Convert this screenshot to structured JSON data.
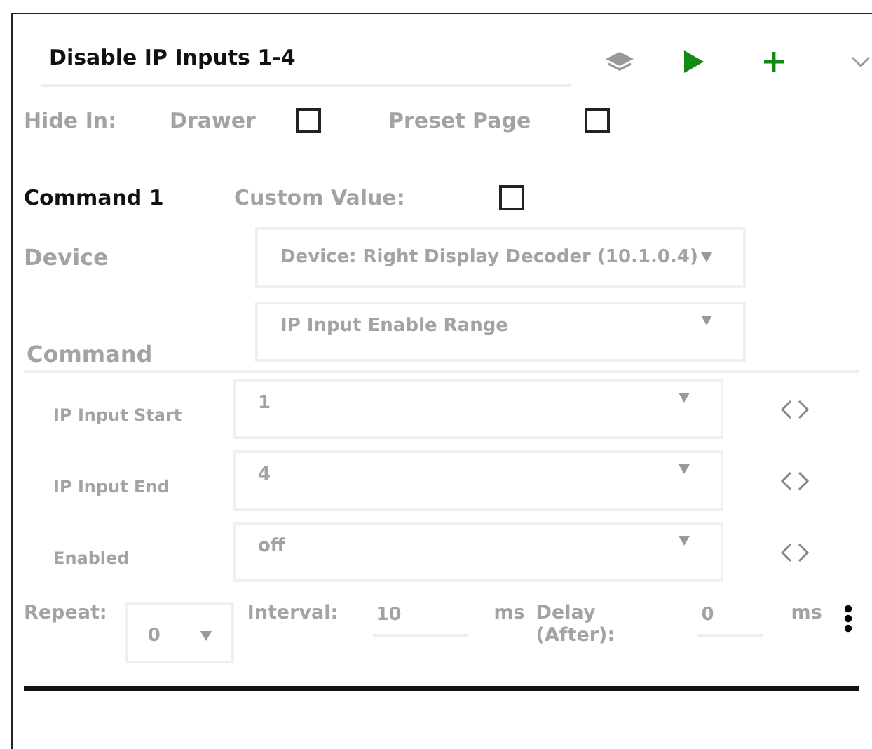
{
  "title": "Disable IP Inputs 1-4",
  "hide_in": {
    "label": "Hide In:",
    "options": [
      {
        "label": "Drawer",
        "checked": false
      },
      {
        "label": "Preset Page",
        "checked": false
      }
    ]
  },
  "command": {
    "heading": "Command 1",
    "custom_value": {
      "label": "Custom Value:",
      "checked": false
    },
    "device": {
      "label": "Device",
      "value": "Device: Right Display Decoder (10.1.0.4)"
    },
    "command": {
      "label": "Command",
      "value": "IP Input Enable Range"
    },
    "params": [
      {
        "label": "IP Input Start",
        "value": "1"
      },
      {
        "label": "IP Input End",
        "value": "4"
      },
      {
        "label": "Enabled",
        "value": "off"
      }
    ]
  },
  "footer": {
    "repeat_label": "Repeat:",
    "repeat": "0",
    "interval_label": "Interval:",
    "interval": "10",
    "interval_unit": "ms",
    "delay_label": "Delay (After):",
    "delay": "0",
    "delay_unit": "ms"
  }
}
